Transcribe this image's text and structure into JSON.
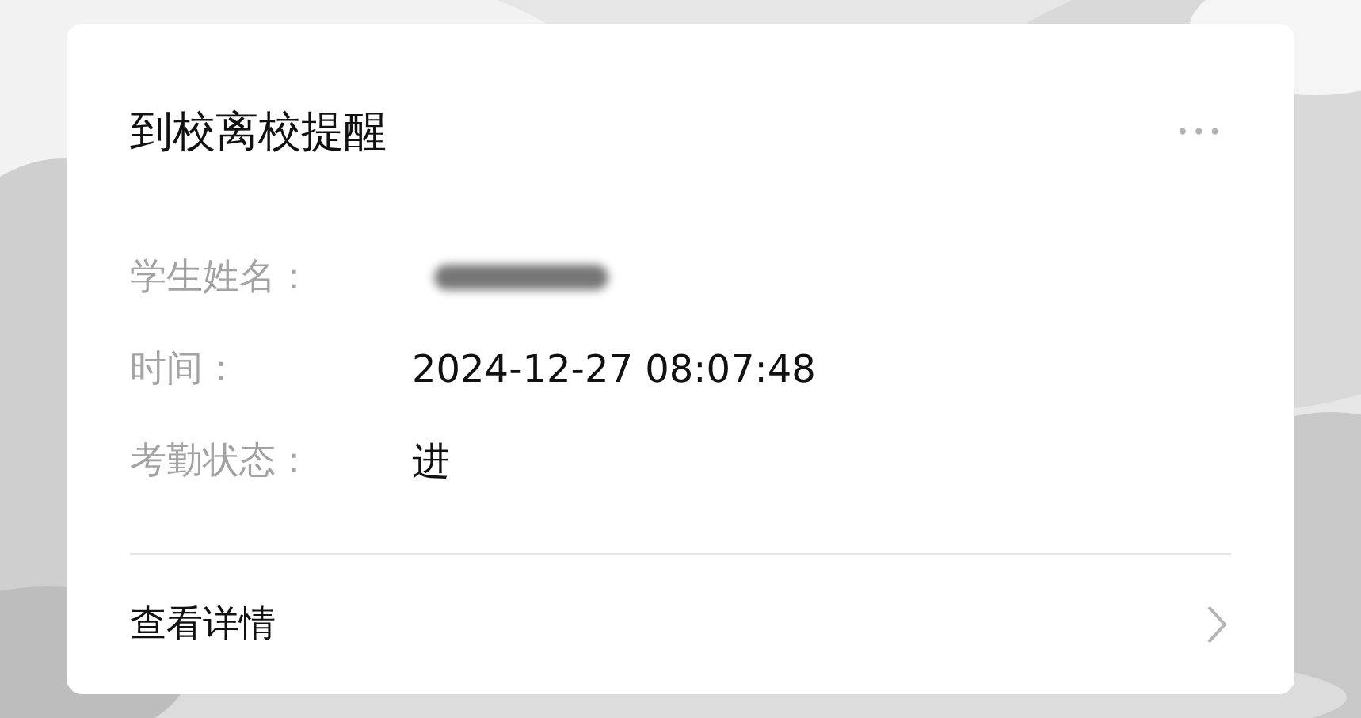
{
  "card": {
    "title": "到校离校提醒",
    "more_icon": "•••",
    "fields": [
      {
        "label": "学生姓名：",
        "kind": "redacted"
      },
      {
        "label": "时间：",
        "kind": "text",
        "value": "2024-12-27 08:07:48"
      },
      {
        "label": "考勤状态：",
        "kind": "text",
        "value": "进"
      }
    ],
    "footer": {
      "label": "查看详情"
    }
  }
}
